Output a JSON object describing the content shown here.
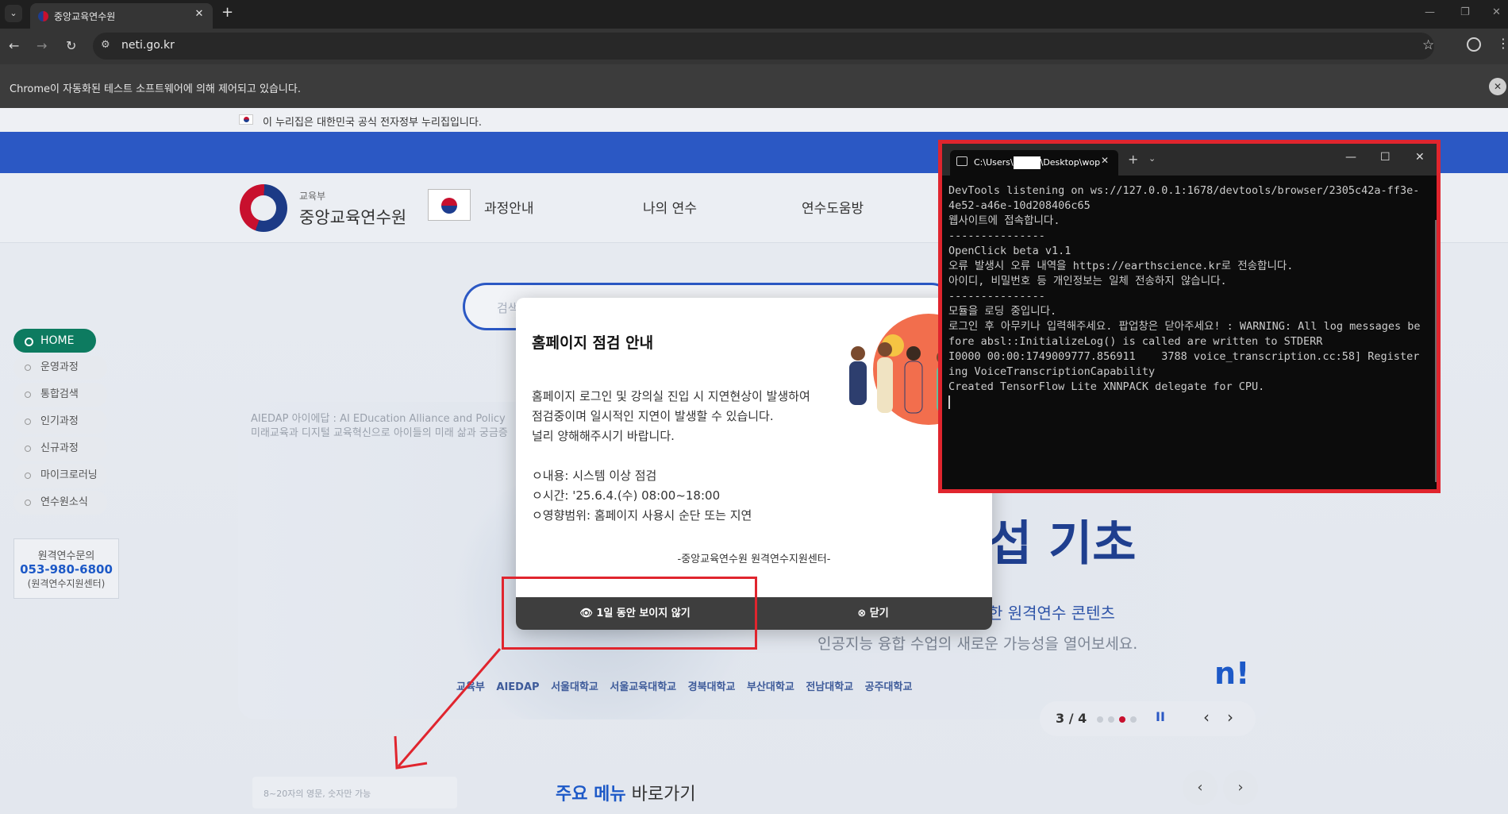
{
  "browser": {
    "tab_title": "중앙교육연수원",
    "url": "neti.go.kr",
    "infobar": "Chrome이 자동화된 테스트 소프트웨어에 의해 제어되고 있습니다.",
    "icons": [
      "tab-list-icon",
      "close-icon",
      "new-tab-icon",
      "back-icon",
      "forward-icon",
      "reload-icon",
      "site-info-icon",
      "bookmark-star-icon",
      "profile-icon",
      "menu-icon"
    ]
  },
  "gov_notice": "이 누리집은 대한민국 공식 전자정부 누리집입니다.",
  "header": {
    "logo_sub": "교육부",
    "logo_main": "중앙교육연수원",
    "nav": [
      "과정안내",
      "나의 연수",
      "연수도움방"
    ]
  },
  "search": {
    "placeholder": "검색"
  },
  "sidenav": {
    "items": [
      "HOME",
      "운영과정",
      "통합검색",
      "인기과정",
      "신규과정",
      "마이크로러닝",
      "연수원소식"
    ],
    "contact_title": "원격연수문의",
    "contact_phone": "053-980-6800",
    "contact_sub": "(원격연수지원센터)"
  },
  "banner": {
    "head": "AIEDAP 아이에답 : AI EDucation Alliance and Policy",
    "sub": "미래교육과 디지털 교육혁신으로 아이들의 미래 삶과 궁금증",
    "title": "섭 기초",
    "desc1": "한 원격연수 콘텐츠",
    "desc2": "인공지능 융합 수업의 새로운 가능성을 열어보세요.",
    "partners": "교육부  AIEDAP  서울대학교  서울교육대학교  경북대학교  부산대학교  전남대학교  공주대학교",
    "pager": "3 / 4",
    "pause_glyph": "II",
    "prev_glyph": "‹",
    "next_glyph": "›"
  },
  "bottom": {
    "input_placeholder": "8~20자의 영문, 숫자만 가능",
    "menu_heading_accent": "주요 메뉴",
    "menu_heading_rest": " 바로가기",
    "prev_glyph": "‹",
    "next_glyph": "›"
  },
  "popup": {
    "title": "홈페이지 점검 안내",
    "body1": "홈페이지 로그인 및 강의실 진입 시 지연현상이 발생하여",
    "body2": "점검중이며 일시적인 지연이 발생할 수 있습니다.",
    "body3": "널리 양해해주시기 바랍니다.",
    "item1": "ㅇ내용: 시스템 이상 점검",
    "item2": "ㅇ시간: '25.6.4.(수) 08:00~18:00",
    "item3": "ㅇ영향범위: 홈페이지 사용시 순단 또는 지연",
    "sign": "-중앙교육연수원 원격연수지원센터-",
    "btn_hide": "1일 동안 보이지 않기",
    "btn_close": "닫기"
  },
  "terminal": {
    "tab_title_prefix": "C:\\Users\\",
    "tab_title_suffix": "\\Desktop\\wop",
    "lines": [
      "DevTools listening on ws://127.0.0.1:1678/devtools/browser/2305c42a-ff3e-4e52-a46e-10d208406c65",
      "웹사이트에 접속합니다.",
      "---------------",
      "OpenClick beta v1.1",
      "오류 발생시 오류 내역을 https://earthscience.kr로 전송합니다.",
      "아이디, 비밀번호 등 개인정보는 일체 전송하지 않습니다.",
      "---------------",
      "모듈을 로딩 중입니다.",
      "로그인 후 아무키나 입력해주세요. 팝업창은 닫아주세요! : WARNING: All log messages before absl::InitializeLog() is called are written to STDERR",
      "I0000 00:00:1749009777.856911    3788 voice_transcription.cc:58] Registering VoiceTranscriptionCapability",
      "Created TensorFlow Lite XNNPACK delegate for CPU."
    ]
  },
  "colors": {
    "accent_blue": "#2b58c4",
    "highlight_red": "#e0252e",
    "home_green": "#0d7b60"
  }
}
